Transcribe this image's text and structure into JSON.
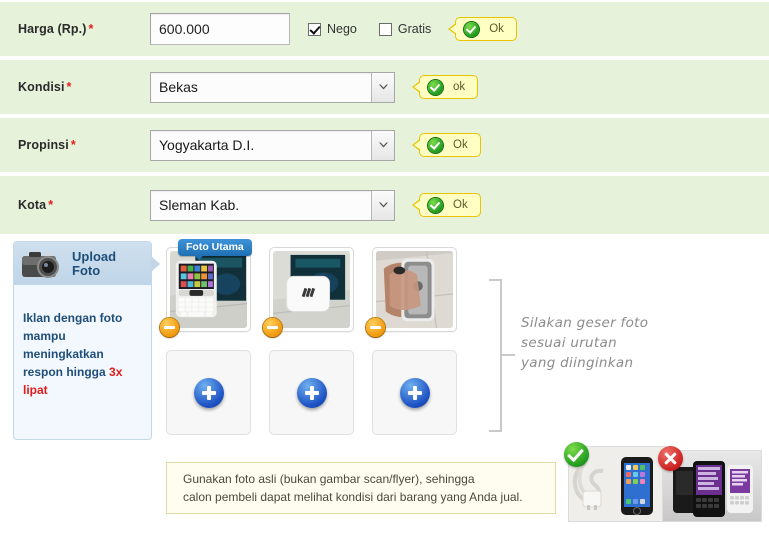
{
  "form": {
    "rows": [
      {
        "label": "Harga (Rp.)",
        "required_mark": "*",
        "type": "text",
        "value": "600.000",
        "placeholder": "",
        "checkboxes": [
          {
            "label": "Nego",
            "checked": true
          },
          {
            "label": "Gratis",
            "checked": false
          }
        ],
        "status": {
          "icon": "check-circle-icon",
          "text": "Ok"
        }
      },
      {
        "label": "Kondisi",
        "required_mark": "*",
        "type": "select",
        "value": "Bekas",
        "status": {
          "icon": "check-circle-icon",
          "text": "ok"
        }
      },
      {
        "label": "Propinsi",
        "required_mark": "*",
        "type": "select",
        "value": "Yogyakarta D.I.",
        "status": {
          "icon": "check-circle-icon",
          "text": "Ok"
        }
      },
      {
        "label": "Kota",
        "required_mark": "*",
        "type": "select",
        "value": "Sleman Kab.",
        "status": {
          "icon": "check-circle-icon",
          "text": "Ok"
        }
      }
    ]
  },
  "upload_panel": {
    "icon": "camera-icon",
    "title_line1": "Upload",
    "title_line2": "Foto",
    "body_line1": "Iklan dengan foto",
    "body_line2": "mampu meningkatkan",
    "body_line3_prefix": "respon hingga ",
    "body_line3_highlight": "3x lipat",
    "highlight_color": "#e01b1b"
  },
  "photos": {
    "main_badge": "Foto Utama",
    "thumbs": [
      {
        "alt": "blackberry-keyboard-phone-front",
        "remove_icon": "minus-circle-icon",
        "is_main": true
      },
      {
        "alt": "white-phone-on-box",
        "remove_icon": "minus-circle-icon",
        "is_main": false
      },
      {
        "alt": "phone-held-in-hand-side",
        "remove_icon": "minus-circle-icon",
        "is_main": false
      }
    ],
    "add_slots": [
      {
        "icon": "plus-circle-icon"
      },
      {
        "icon": "plus-circle-icon"
      },
      {
        "icon": "plus-circle-icon"
      }
    ],
    "drag_hint": "Silakan geser foto\nsesuai urutan\nyang diinginkan"
  },
  "note": {
    "text": "Gunakan foto asli (bukan gambar scan/flyer), sehingga\ncalon pembeli dapat melihat kondisi dari barang yang Anda jual."
  },
  "examples": [
    {
      "name": "good-example",
      "mark": "check-circle-icon",
      "alt": "real-photo-phone-with-charger-cable"
    },
    {
      "name": "bad-example",
      "mark": "cross-circle-icon",
      "alt": "catalog-render-of-blackberry-phones"
    }
  ],
  "colors": {
    "row_bg": "#e6f2da",
    "callout_bg": "#ffffc4",
    "callout_border": "#e8c400",
    "panel_bg": "#f2f8fd",
    "panel_head": "#cfe0ef",
    "panel_text": "#1f4e79",
    "note_bg": "#fffdf0",
    "note_border": "#e3d9a8",
    "badge_blue": "#2f83cc",
    "required_red": "#e02020"
  }
}
